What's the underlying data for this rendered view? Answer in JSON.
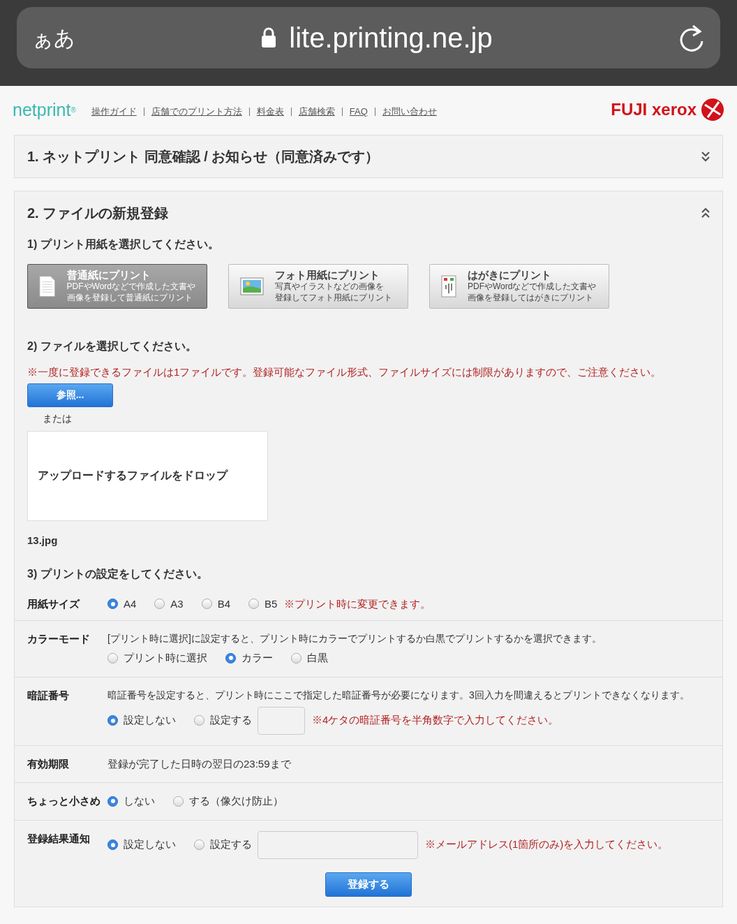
{
  "browser_bar": {
    "text_size": "ぁあ",
    "url": "lite.printing.ne.jp"
  },
  "header": {
    "logo": "netprint",
    "logo_mark": "®",
    "nav": [
      "操作ガイド",
      "店舗でのプリント方法",
      "料金表",
      "店舗検索",
      "FAQ",
      "お問い合わせ"
    ],
    "brand": "FUJI xerox"
  },
  "sections": [
    {
      "title": "1. ネットプリント 同意確認 / お知らせ（同意済みです）",
      "expanded": false
    },
    {
      "title": "2. ファイルの新規登録",
      "expanded": true
    }
  ],
  "step1": {
    "label": "1) プリント用紙を選択してください。",
    "paper_buttons": [
      {
        "kind": "document",
        "title": "普通紙にプリント",
        "lines": [
          "PDFやWordなどで作成した文書や",
          "画像を登録して普通紙にプリント"
        ],
        "selected": true
      },
      {
        "kind": "photo",
        "title": "フォト用紙にプリント",
        "lines": [
          "写真やイラストなどの画像を",
          "登録してフォト用紙にプリント"
        ],
        "selected": false
      },
      {
        "kind": "postcard",
        "title": "はがきにプリント",
        "lines": [
          "PDFやWordなどで作成した文書や",
          "画像を登録してはがきにプリント"
        ],
        "selected": false
      }
    ]
  },
  "step2": {
    "label": "2) ファイルを選択してください。",
    "note": "※一度に登録できるファイルは1ファイルです。登録可能なファイル形式、ファイルサイズには制限がありますので、ご注意ください。",
    "browse_button": "参照...",
    "or_text": "または",
    "drop_zone": "アップロードするファイルをドロップ",
    "file_name": "13.jpg"
  },
  "step3": {
    "label": "3) プリントの設定をしてください。",
    "rows": [
      {
        "label": "用紙サイズ",
        "options": [
          {
            "label": "A4",
            "selected": true
          },
          {
            "label": "A3",
            "selected": false
          },
          {
            "label": "B4",
            "selected": false
          },
          {
            "label": "B5",
            "selected": false
          }
        ],
        "note": "※プリント時に変更できます。"
      },
      {
        "label": "カラーモード",
        "description": "[プリント時に選択]に設定すると、プリント時にカラーでプリントするか白黒でプリントするかを選択できます。",
        "options": [
          {
            "label": "プリント時に選択",
            "selected": false
          },
          {
            "label": "カラー",
            "selected": true
          },
          {
            "label": "白黒",
            "selected": false
          }
        ]
      },
      {
        "label": "暗証番号",
        "description": "暗証番号を設定すると、プリント時にここで指定した暗証番号が必要になります。3回入力を間違えるとプリントできなくなります。",
        "options": [
          {
            "label": "設定しない",
            "selected": true
          },
          {
            "label": "設定する",
            "selected": false
          }
        ],
        "field": {
          "kind": "short"
        },
        "note": "※4ケタの暗証番号を半角数字で入力してください。"
      },
      {
        "label": "有効期限",
        "text": "登録が完了した日時の翌日の23:59まで"
      },
      {
        "label": "ちょっと小さめ",
        "options": [
          {
            "label": "しない",
            "selected": true
          },
          {
            "label": "する（像欠け防止）",
            "selected": false
          }
        ]
      },
      {
        "label": "登録結果通知",
        "options": [
          {
            "label": "設定しない",
            "selected": true
          },
          {
            "label": "設定する",
            "selected": false
          }
        ],
        "field": {
          "kind": "wide"
        },
        "note": "※メールアドレス(1箇所のみ)を入力してください。"
      }
    ]
  },
  "submit_button": "登録する"
}
